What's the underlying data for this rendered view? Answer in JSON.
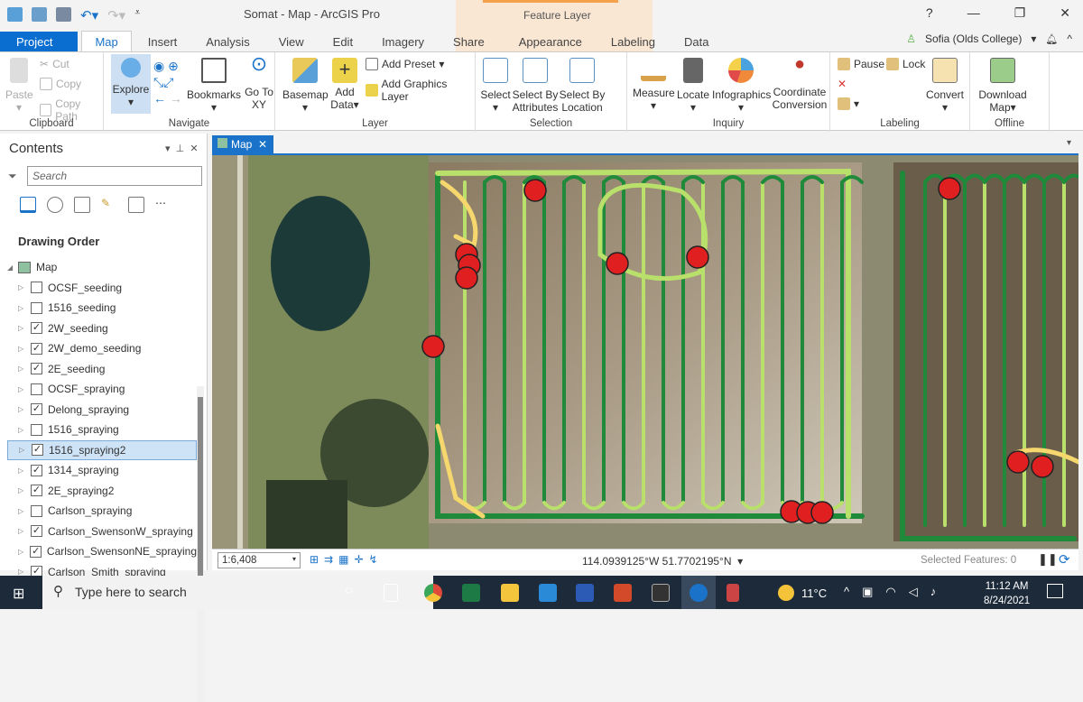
{
  "window": {
    "title": "Somat - Map - ArcGIS Pro",
    "context_tab_group": "Feature Layer",
    "help": "?",
    "minimize": "—",
    "restore": "❐",
    "close": "✕"
  },
  "tabs": [
    "Project",
    "Map",
    "Insert",
    "Analysis",
    "View",
    "Edit",
    "Imagery",
    "Share",
    "Appearance",
    "Labeling",
    "Data"
  ],
  "active_tab": "Map",
  "user": {
    "name": "Sofia (Olds College)",
    "bell": "🔔",
    "collapse": "^"
  },
  "ribbon": {
    "clipboard": {
      "label": "Clipboard",
      "paste": "Paste",
      "cut": "Cut",
      "copy": "Copy",
      "copy_path": "Copy Path"
    },
    "navigate": {
      "label": "Navigate",
      "explore": "Explore",
      "bookmarks": "Bookmarks",
      "go_to_xy": "Go To XY"
    },
    "layer": {
      "label": "Layer",
      "basemap": "Basemap",
      "add_data": "Add Data",
      "add_preset": "Add Preset",
      "add_graphics_layer": "Add Graphics Layer"
    },
    "selection": {
      "label": "Selection",
      "select": "Select",
      "select_by_attributes": "Select By Attributes",
      "select_by_location": "Select By Location"
    },
    "inquiry": {
      "label": "Inquiry",
      "measure": "Measure",
      "locate": "Locate",
      "infographics": "Infographics",
      "coordinate_conversion": "Coordinate Conversion"
    },
    "labeling": {
      "label": "Labeling",
      "pause": "Pause",
      "lock": "Lock",
      "convert": "Convert"
    },
    "offline": {
      "label": "Offline",
      "download_map": "Download Map"
    }
  },
  "contents": {
    "title": "Contents",
    "search_placeholder": "Search",
    "heading": "Drawing Order",
    "map_node": "Map",
    "layers": [
      {
        "name": "OCSF_seeding",
        "checked": false
      },
      {
        "name": "1516_seeding",
        "checked": false
      },
      {
        "name": "2W_seeding",
        "checked": true
      },
      {
        "name": "2W_demo_seeding",
        "checked": true
      },
      {
        "name": "2E_seeding",
        "checked": true
      },
      {
        "name": "OCSF_spraying",
        "checked": false
      },
      {
        "name": "Delong_spraying",
        "checked": true
      },
      {
        "name": "1516_spraying",
        "checked": false
      },
      {
        "name": "1516_spraying2",
        "checked": true,
        "selected": true
      },
      {
        "name": "1314_spraying",
        "checked": true
      },
      {
        "name": "2E_spraying2",
        "checked": true
      },
      {
        "name": "Carlson_spraying",
        "checked": false
      },
      {
        "name": "Carlson_SwensonW_spraying",
        "checked": true
      },
      {
        "name": "Carlson_SwensonNE_spraying",
        "checked": true
      },
      {
        "name": "Carlson_Smith_spraying",
        "checked": true
      }
    ]
  },
  "map_view": {
    "tab_label": "Map",
    "scale": "1:6,408",
    "coordinates": "114.0939125°W 51.7702195°N",
    "selected_features": "Selected Features: 0"
  },
  "colors": {
    "accent": "#1a73c9",
    "track_green": "#1e8a3a",
    "track_light": "#b8e06a",
    "track_yellow": "#f5d76e",
    "point_red": "#e02020"
  },
  "taskbar": {
    "search_placeholder": "Type here to search",
    "weather": "11°C",
    "time": "11:12 AM",
    "date": "8/24/2021"
  }
}
